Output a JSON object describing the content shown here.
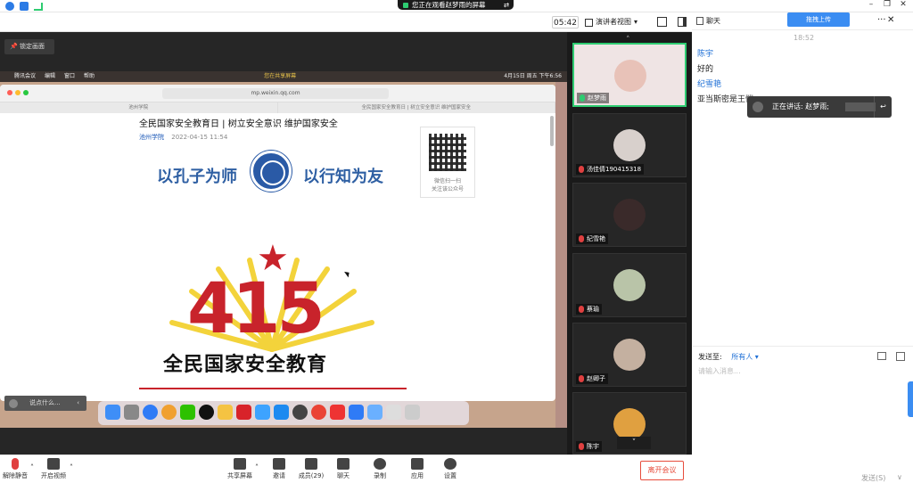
{
  "topbar": {
    "viewing_text": "您正在观看赵梦雨的屏幕",
    "arrows_icon": "swap-icon"
  },
  "toolbar2": {
    "timer": "05:42",
    "view_mode": "演讲者视图",
    "chat_title": "聊天"
  },
  "stage": {
    "stop_label": "锁定画面",
    "say_placeholder": "说点什么...",
    "mac_menu": [
      "腾讯会议",
      "编辑",
      "窗口",
      "帮助"
    ],
    "mac_status": "4月15日 周五 下午6:56",
    "mac_notice": "您在共享屏幕",
    "url": "mp.weixin.qq.com",
    "tab1": "池州学院",
    "tab2": "全民国家安全教育日 | 树立安全意识 维护国家安全",
    "article_title": "全民国家安全教育日 | 树立安全意识 维护国家安全",
    "article_source": "池州学院",
    "article_date": "2022-04-15 11:54",
    "slogan_left": "以孔子为师",
    "slogan_right": "以行知为友",
    "qr_line1": "微信扫一扫",
    "qr_line2": "关注该公众号",
    "big_number": "415",
    "big_slogan": "全民国家安全教育"
  },
  "participants": [
    {
      "name": "赵梦雨",
      "mic": "on"
    },
    {
      "name": "汤佳倩190415318",
      "mic": "off"
    },
    {
      "name": "纪雪艳",
      "mic": "off"
    },
    {
      "name": "蔡瑜",
      "mic": "off"
    },
    {
      "name": "赵卿子",
      "mic": "off"
    },
    {
      "name": "陈宇",
      "mic": "off"
    }
  ],
  "chat": {
    "upload_label": "拖拽上传",
    "time": "18:52",
    "messages": [
      {
        "sender": "陈宇",
        "text": "好的"
      },
      {
        "sender": "纪雪艳",
        "text": "亚当斯密是王恺"
      }
    ],
    "speaking_label": "正在讲话: 赵梦雨;",
    "send_to_label": "发送至:",
    "send_to_value": "所有人",
    "input_placeholder": "请输入消息...",
    "send_button": "发送(S)"
  },
  "bottom": {
    "unmute": "解除静音",
    "start_video": "开启视频",
    "share_screen": "共享屏幕",
    "invite": "邀请",
    "members": "成员(29)",
    "chat": "聊天",
    "record": "录制",
    "apps": "应用",
    "settings": "设置",
    "leave": "离开会议"
  },
  "colors": {
    "accent_green": "#2ecc71",
    "accent_blue": "#1e6fd6",
    "danger": "#e74c3c",
    "poster_red": "#c8232b"
  }
}
